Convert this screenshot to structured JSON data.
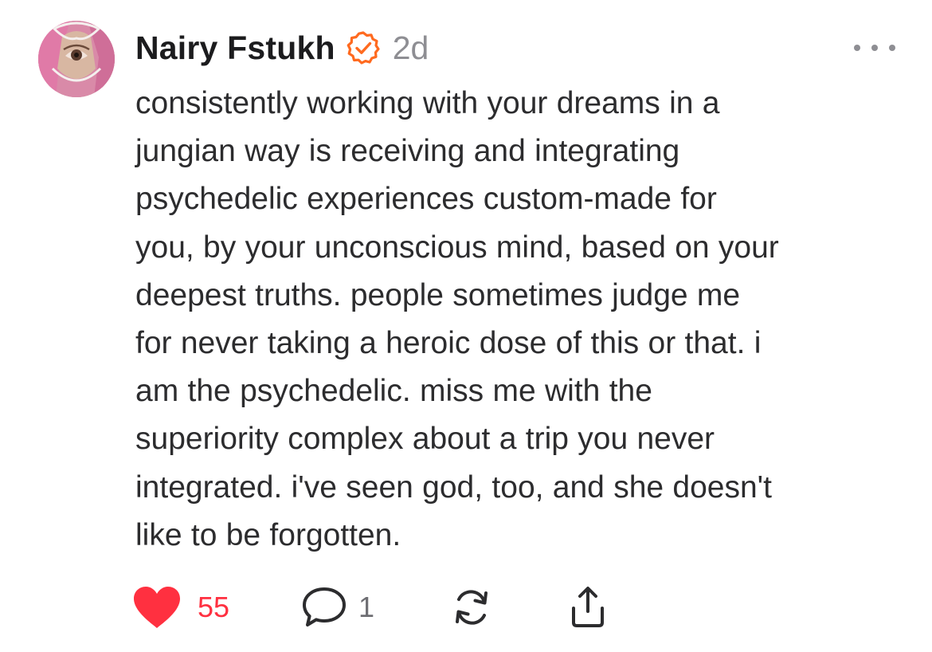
{
  "post": {
    "author_name": "Nairy Fstukh",
    "timestamp": "2d",
    "text_lines": [
      "consistently working with your dreams in a",
      "jungian way is receiving and integrating",
      "psychedelic experiences custom-made for",
      "you, by your unconscious mind, based on your",
      "deepest truths. people sometimes judge me",
      "for never taking a heroic dose of this or that. i",
      "am the psychedelic. miss me with the",
      "superiority complex about a trip you never",
      "integrated. i've seen god, too, and she doesn't",
      "like to be forgotten."
    ],
    "likes": "55",
    "replies": "1"
  },
  "icons": {
    "verified": "verified-badge-icon",
    "more": "more-options-icon",
    "like": "heart-icon",
    "reply": "comment-bubble-icon",
    "repost": "repost-icon",
    "share": "share-icon"
  },
  "colors": {
    "verified_badge": "#ff6a1f",
    "like_active": "#ff3040",
    "secondary_text": "#8e8e93",
    "primary_text": "#1c1c1e"
  }
}
